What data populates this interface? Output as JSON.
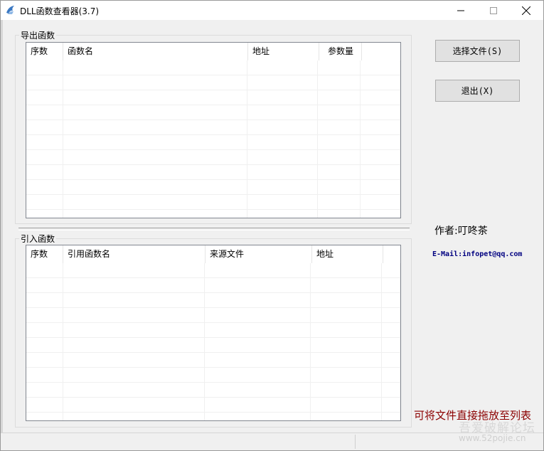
{
  "window": {
    "title": "DLL函数查看器(3.7)"
  },
  "export_group": {
    "label": "导出函数",
    "columns": [
      "序数",
      "函数名",
      "地址",
      "参数量",
      ""
    ]
  },
  "import_group": {
    "label": "引入函数",
    "columns": [
      "序数",
      "引用函数名",
      "来源文件",
      "地址",
      ""
    ]
  },
  "buttons": {
    "select_file": "选择文件(S)",
    "exit": "退出(X)"
  },
  "info": {
    "author": "作者:叮咚茶",
    "email": "E-Mail:infopet@qq.com",
    "hint": "可将文件直接拖放至列表"
  },
  "watermark": {
    "line1": "吾爱破解论坛",
    "line2": "www.52pojie.cn"
  }
}
